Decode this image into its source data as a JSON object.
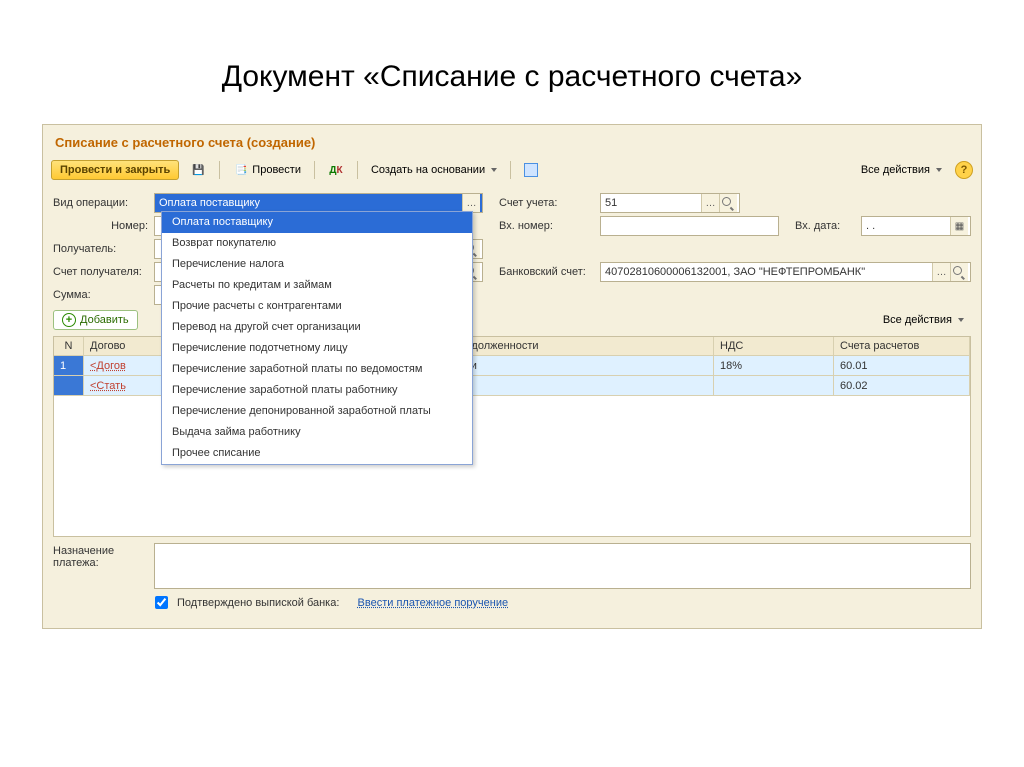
{
  "slide_title": "Документ «Списание с расчетного счета»",
  "form_title": "Списание с расчетного счета (создание)",
  "toolbar": {
    "post_close": "Провести и закрыть",
    "post": "Провести",
    "based_on": "Создать на основании",
    "all_actions": "Все действия"
  },
  "labels": {
    "op_type": "Вид операции:",
    "number": "Номер:",
    "recipient": "Получатель:",
    "recipient_account": "Счет получателя:",
    "sum": "Сумма:",
    "account": "Счет учета:",
    "in_number": "Вх. номер:",
    "in_date": "Вх. дата:",
    "bank_account": "Банковский счет:",
    "add": "Добавить",
    "all_actions2": "Все действия",
    "purpose": "Назначение платежа:",
    "confirmed": "Подтверждено выпиской банка:",
    "enter_payment_order": "Ввести платежное поручение"
  },
  "values": {
    "op_type": "Оплата поставщику",
    "account": "51",
    "bank_account": "40702810600006132001, ЗАО \"НЕФТЕПРОМБАНК\"",
    "in_date": ". ."
  },
  "op_options": [
    "Оплата поставщику",
    "Возврат покупателю",
    "Перечисление налога",
    "Расчеты по кредитам и займам",
    "Прочие расчеты с контрагентами",
    "Перевод на другой счет организации",
    "Перечисление подотчетному лицу",
    "Перечисление заработной платы по ведомостям",
    "Перечисление заработной платы работнику",
    "Перечисление депонированной заработной платы",
    "Выдача займа работнику",
    "Прочее списание"
  ],
  "grid": {
    "headers": {
      "n": "N",
      "dg": "Догово",
      "pd": "Погашение задолженности",
      "nds": "НДС",
      "sr": "Счета расчетов"
    },
    "rows": [
      {
        "n": "1",
        "dg": "<Догов",
        "pd": "Автоматически",
        "nds": "18%",
        "sr": "60.01"
      },
      {
        "n": "",
        "dg": "<Стать",
        "pd": "",
        "nds": "",
        "sr": "60.02"
      }
    ]
  }
}
